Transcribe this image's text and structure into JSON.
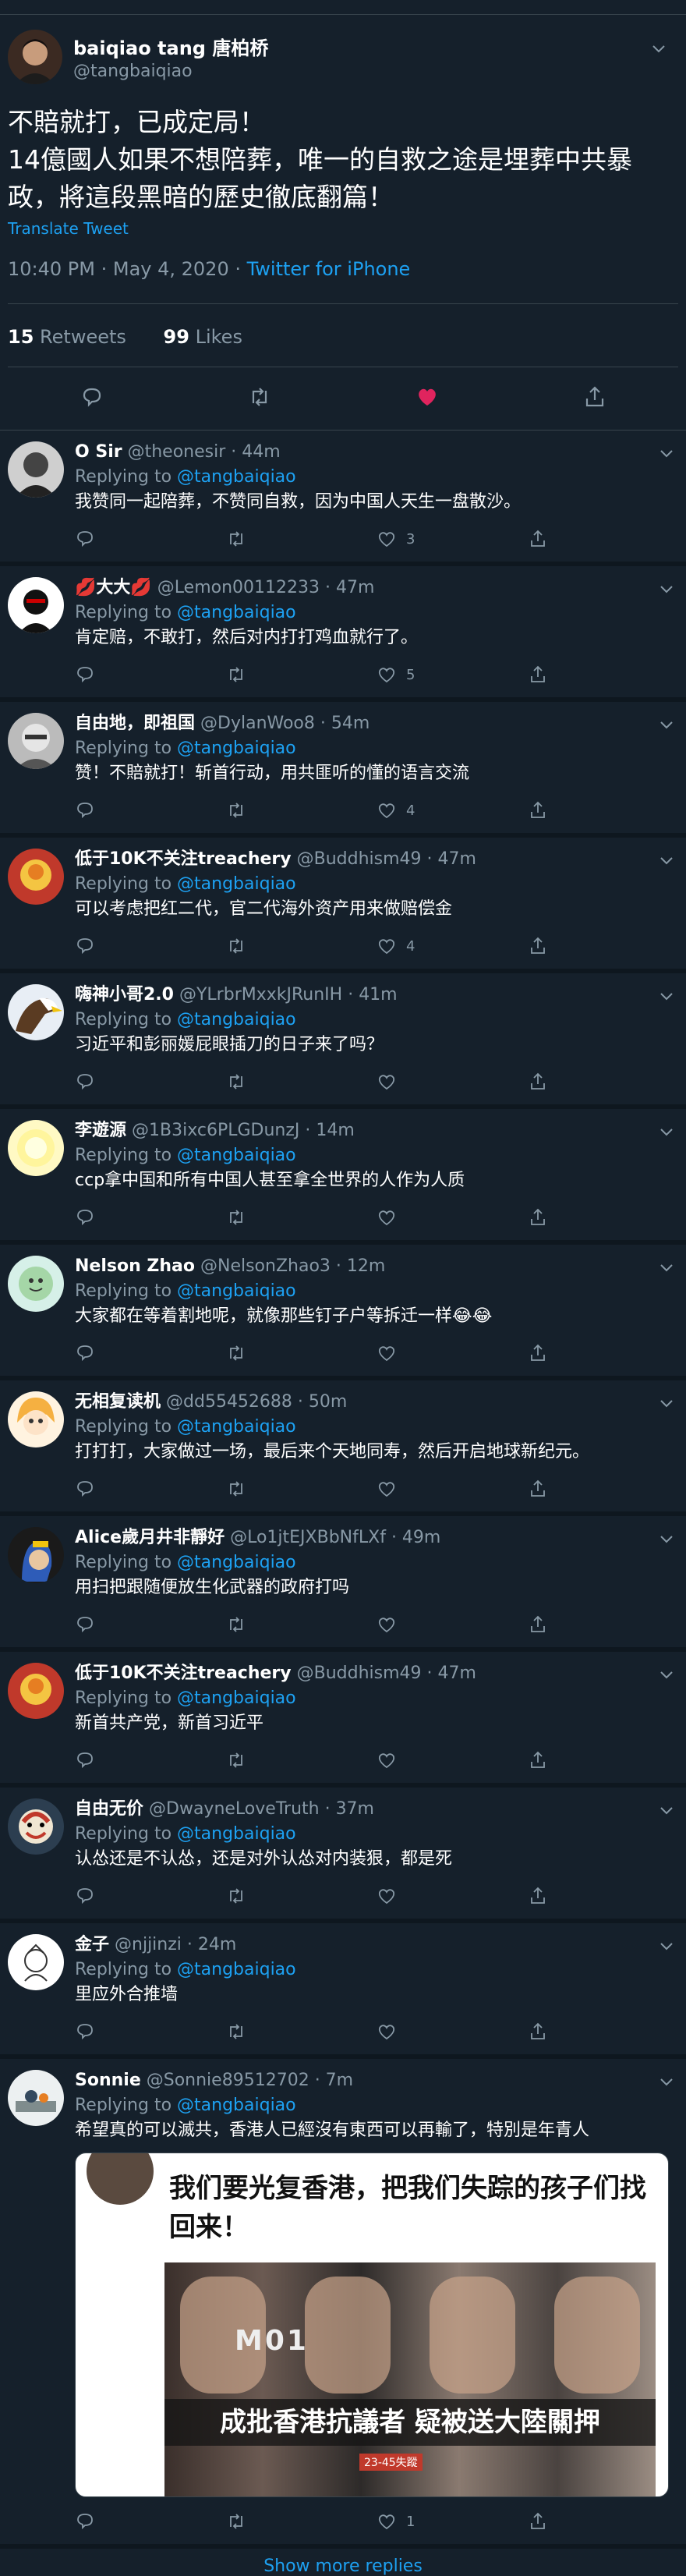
{
  "main_tweet": {
    "name": "baiqiao tang 唐柏桥",
    "handle": "@tangbaiqiao",
    "text": "不賠就打，已成定局！\n14億國人如果不想陪葬，唯一的自救之途是埋葬中共暴政，將這段黑暗的歷史徹底翻篇！",
    "translate": "Translate Tweet",
    "time": "10:40 PM · May 4, 2020 · ",
    "source": "Twitter for iPhone",
    "retweets": "15",
    "retweets_label": "Retweets",
    "likes": "99",
    "likes_label": "Likes"
  },
  "colors": {
    "background": "#15202b",
    "secondary_text": "#8899a6",
    "link": "#1da1f2",
    "like_active": "#e0245e"
  },
  "replies": [
    {
      "name": "O Sir",
      "handle": "@theonesir",
      "time": "· 44m",
      "replying_to": "@tangbaiqiao",
      "text": "我赞同一起陪葬，不赞同自救，因为中国人天生一盘散沙。",
      "likes": "3"
    },
    {
      "name": "💋大大💋",
      "handle": "@Lemon00112233",
      "time": "· 47m",
      "replying_to": "@tangbaiqiao",
      "text": "肯定赔，不敢打，然后对内打打鸡血就行了。",
      "likes": "5"
    },
    {
      "name": "自由地，即祖国",
      "handle": "@DylanWoo8",
      "time": "· 54m",
      "replying_to": "@tangbaiqiao",
      "text": "赞！不賠就打！斩首行动，用共匪听的懂的语言交流",
      "likes": "4"
    },
    {
      "name": "低于10K不关注treachery",
      "handle": "@Buddhism49",
      "time": "· 47m",
      "replying_to": "@tangbaiqiao",
      "text": "可以考虑把红二代，官二代海外资产用来做赔偿金",
      "likes": "4"
    },
    {
      "name": "嗨神小哥2.0",
      "handle": "@YLrbrMxxkJRunIH",
      "time": "· 41m",
      "replying_to": "@tangbaiqiao",
      "text": "习近平和彭丽媛屁眼插刀的日子来了吗？",
      "likes": ""
    },
    {
      "name": "李遊源",
      "handle": "@1B3ixc6PLGDunzJ",
      "time": "· 14m",
      "replying_to": "@tangbaiqiao",
      "text": "ccp拿中国和所有中国人甚至拿全世界的人作为人质",
      "likes": ""
    },
    {
      "name": "Nelson Zhao",
      "handle": "@NelsonZhao3",
      "time": "· 12m",
      "replying_to": "@tangbaiqiao",
      "text": "大家都在等着割地呢，就像那些钉子户等拆迁一样😂😂",
      "likes": ""
    },
    {
      "name": "无相复读机",
      "handle": "@dd55452688",
      "time": "· 50m",
      "replying_to": "@tangbaiqiao",
      "text": "打打打，大家做过一场，最后来个天地同寿，然后开启地球新纪元。",
      "likes": ""
    },
    {
      "name": "Alice歲月井非靜好",
      "handle": "@Lo1jtEJXBbNfLXf",
      "time": "· 49m",
      "replying_to": "@tangbaiqiao",
      "text": "用扫把跟随便放生化武器的政府打吗",
      "likes": ""
    },
    {
      "name": "低于10K不关注treachery",
      "handle": "@Buddhism49",
      "time": "· 47m",
      "replying_to": "@tangbaiqiao",
      "text": "新首共产党，新首习近平",
      "likes": ""
    },
    {
      "name": "自由无价",
      "handle": "@DwayneLoveTruth",
      "time": "· 37m",
      "replying_to": "@tangbaiqiao",
      "text": "认怂还是不认怂，还是对外认怂对内装狠，都是死",
      "likes": ""
    },
    {
      "name": "金子",
      "handle": "@njjinzi",
      "time": "· 24m",
      "replying_to": "@tangbaiqiao",
      "text": "里应外合推墙",
      "likes": ""
    },
    {
      "name": "Sonnie",
      "handle": "@Sonnie89512702",
      "time": "· 7m",
      "replying_to": "@tangbaiqiao",
      "text": "希望真的可以滅共，香港人已經沒有東西可以再輸了，特別是年青人",
      "likes": "1",
      "embed": {
        "title": "我们要光复香港，把我们失踪的孩子们找回来！",
        "banner": "成批香港抗議者 疑被送大陸關押",
        "overlay": "M01",
        "date_tag": "23-45失蹤"
      }
    }
  ],
  "replying_label": "Replying to",
  "show_more": "Show more replies"
}
